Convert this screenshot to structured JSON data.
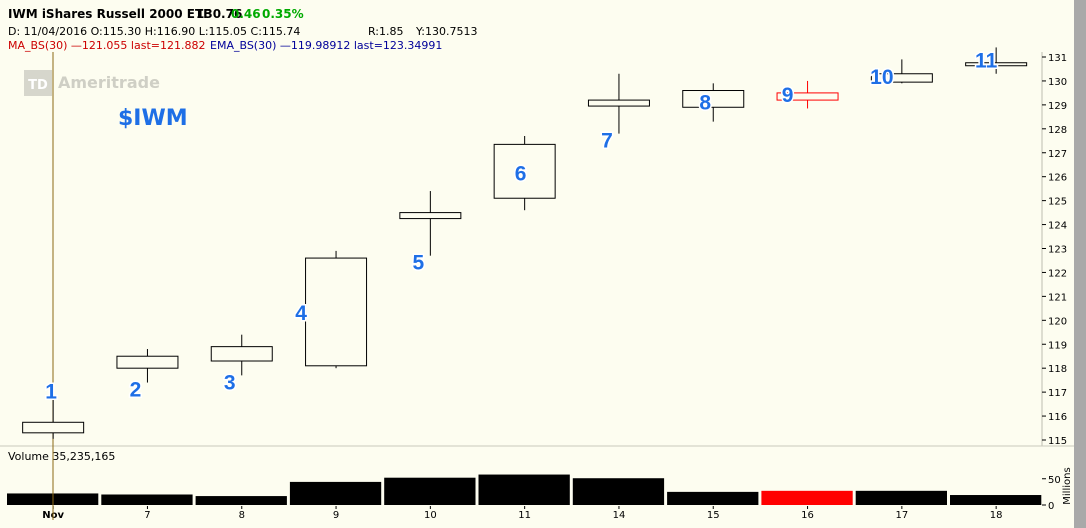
{
  "header": {
    "symbol_title": "IWM iShares Russell 2000 ETF",
    "last": "130.76",
    "change": "0.46",
    "change_pct": "0.35%",
    "ohlc_line": "D: 11/04/2016 O:115.30 H:116.90 L:115.05 C:115.74",
    "r_readout": "R:1.85",
    "y_readout": "Y:130.7513",
    "ma_label": "MA_BS(30) —121.055 last=121.882",
    "ema_label": "EMA_BS(30) —119.98912 last=123.34991",
    "volume_label": "Volume 35,235,165",
    "watermark": "Ameritrade",
    "watermark_logo": "TD",
    "ticker_overlay": "$IWM",
    "volume_unit": "Millions"
  },
  "colors": {
    "background": "#fdfdf0",
    "up_candle": "#000000",
    "highlight_candle": "#ff0000",
    "change_positive": "#00aa00",
    "ma_text": "#cc0000",
    "ema_text": "#000099",
    "number_label": "#1e6fe6",
    "cursor_line": "#8b6914"
  },
  "chart_data": {
    "type": "candlestick",
    "categories": [
      "Nov",
      "7",
      "8",
      "9",
      "10",
      "11",
      "14",
      "15",
      "16",
      "17",
      "18"
    ],
    "candles": [
      {
        "label": "1",
        "open": 115.3,
        "high": 116.9,
        "low": 115.05,
        "close": 115.74,
        "color": "#000000"
      },
      {
        "label": "2",
        "open": 118.0,
        "high": 118.8,
        "low": 117.4,
        "close": 118.5,
        "color": "#000000"
      },
      {
        "label": "3",
        "open": 118.3,
        "high": 119.4,
        "low": 117.7,
        "close": 118.9,
        "color": "#000000"
      },
      {
        "label": "4",
        "open": 118.1,
        "high": 122.9,
        "low": 118.0,
        "close": 122.6,
        "color": "#000000"
      },
      {
        "label": "5",
        "open": 124.25,
        "high": 125.4,
        "low": 122.7,
        "close": 124.5,
        "color": "#000000"
      },
      {
        "label": "6",
        "open": 125.1,
        "high": 127.7,
        "low": 124.6,
        "close": 127.35,
        "color": "#000000"
      },
      {
        "label": "7",
        "open": 128.95,
        "high": 130.3,
        "low": 127.8,
        "close": 129.2,
        "color": "#000000"
      },
      {
        "label": "8",
        "open": 128.9,
        "high": 129.9,
        "low": 128.3,
        "close": 129.6,
        "color": "#000000"
      },
      {
        "label": "9",
        "open": 129.2,
        "high": 130.0,
        "low": 128.85,
        "close": 129.5,
        "color": "#ff0000"
      },
      {
        "label": "10",
        "open": 129.95,
        "high": 130.9,
        "low": 129.9,
        "close": 130.3,
        "color": "#000000"
      },
      {
        "label": "11",
        "open": 130.65,
        "high": 131.4,
        "low": 130.3,
        "close": 130.76,
        "color": "#000000"
      }
    ],
    "volume": [
      22,
      20,
      17,
      44,
      52,
      58,
      51,
      25,
      27,
      27,
      19
    ],
    "volume_colors": [
      "#000000",
      "#000000",
      "#000000",
      "#000000",
      "#000000",
      "#000000",
      "#000000",
      "#000000",
      "#ff0000",
      "#000000",
      "#000000"
    ],
    "ylim": [
      115,
      131
    ],
    "y_ticks": [
      115,
      116,
      117,
      118,
      119,
      120,
      121,
      122,
      123,
      124,
      125,
      126,
      127,
      128,
      129,
      130,
      131
    ],
    "volume_ylim": [
      0,
      80
    ],
    "volume_ticks": [
      0,
      50
    ],
    "grid": false
  }
}
